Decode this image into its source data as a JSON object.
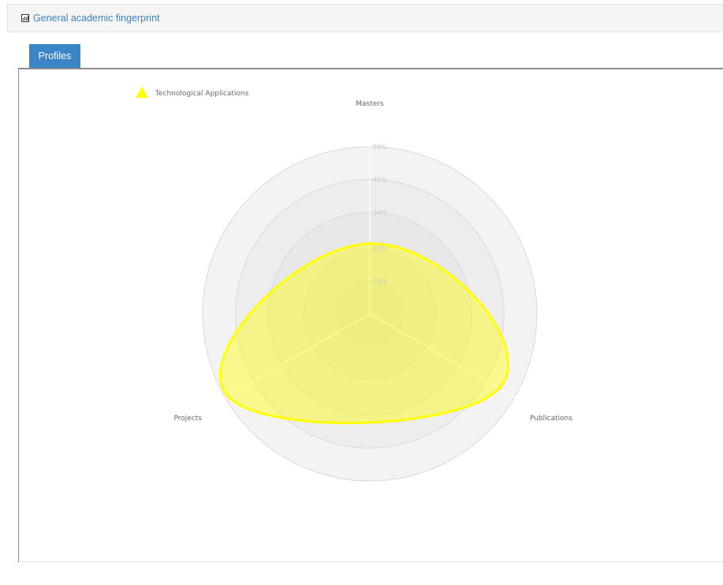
{
  "header": {
    "title": "General academic fingerprint",
    "icon": "bar-chart-icon"
  },
  "tabs": [
    {
      "label": "Profiles",
      "active": true
    }
  ],
  "colors": {
    "tab_active": "#3b85c6",
    "link": "#3b82c2",
    "series": "#ffff00"
  },
  "chart_data": {
    "type": "radar",
    "categories": [
      "Masters",
      "Publications",
      "Projects"
    ],
    "series": [
      {
        "name": "Technological Applications",
        "values": [
          23.5,
          50,
          55
        ],
        "color": "#ffff00"
      }
    ],
    "ticks": [
      "11%",
      "22%",
      "34%",
      "45%",
      "56%"
    ],
    "tick_values": [
      11,
      22,
      34,
      45,
      56
    ],
    "rmax": 56,
    "legend_position": "top-left",
    "line_style": "smoothed"
  }
}
